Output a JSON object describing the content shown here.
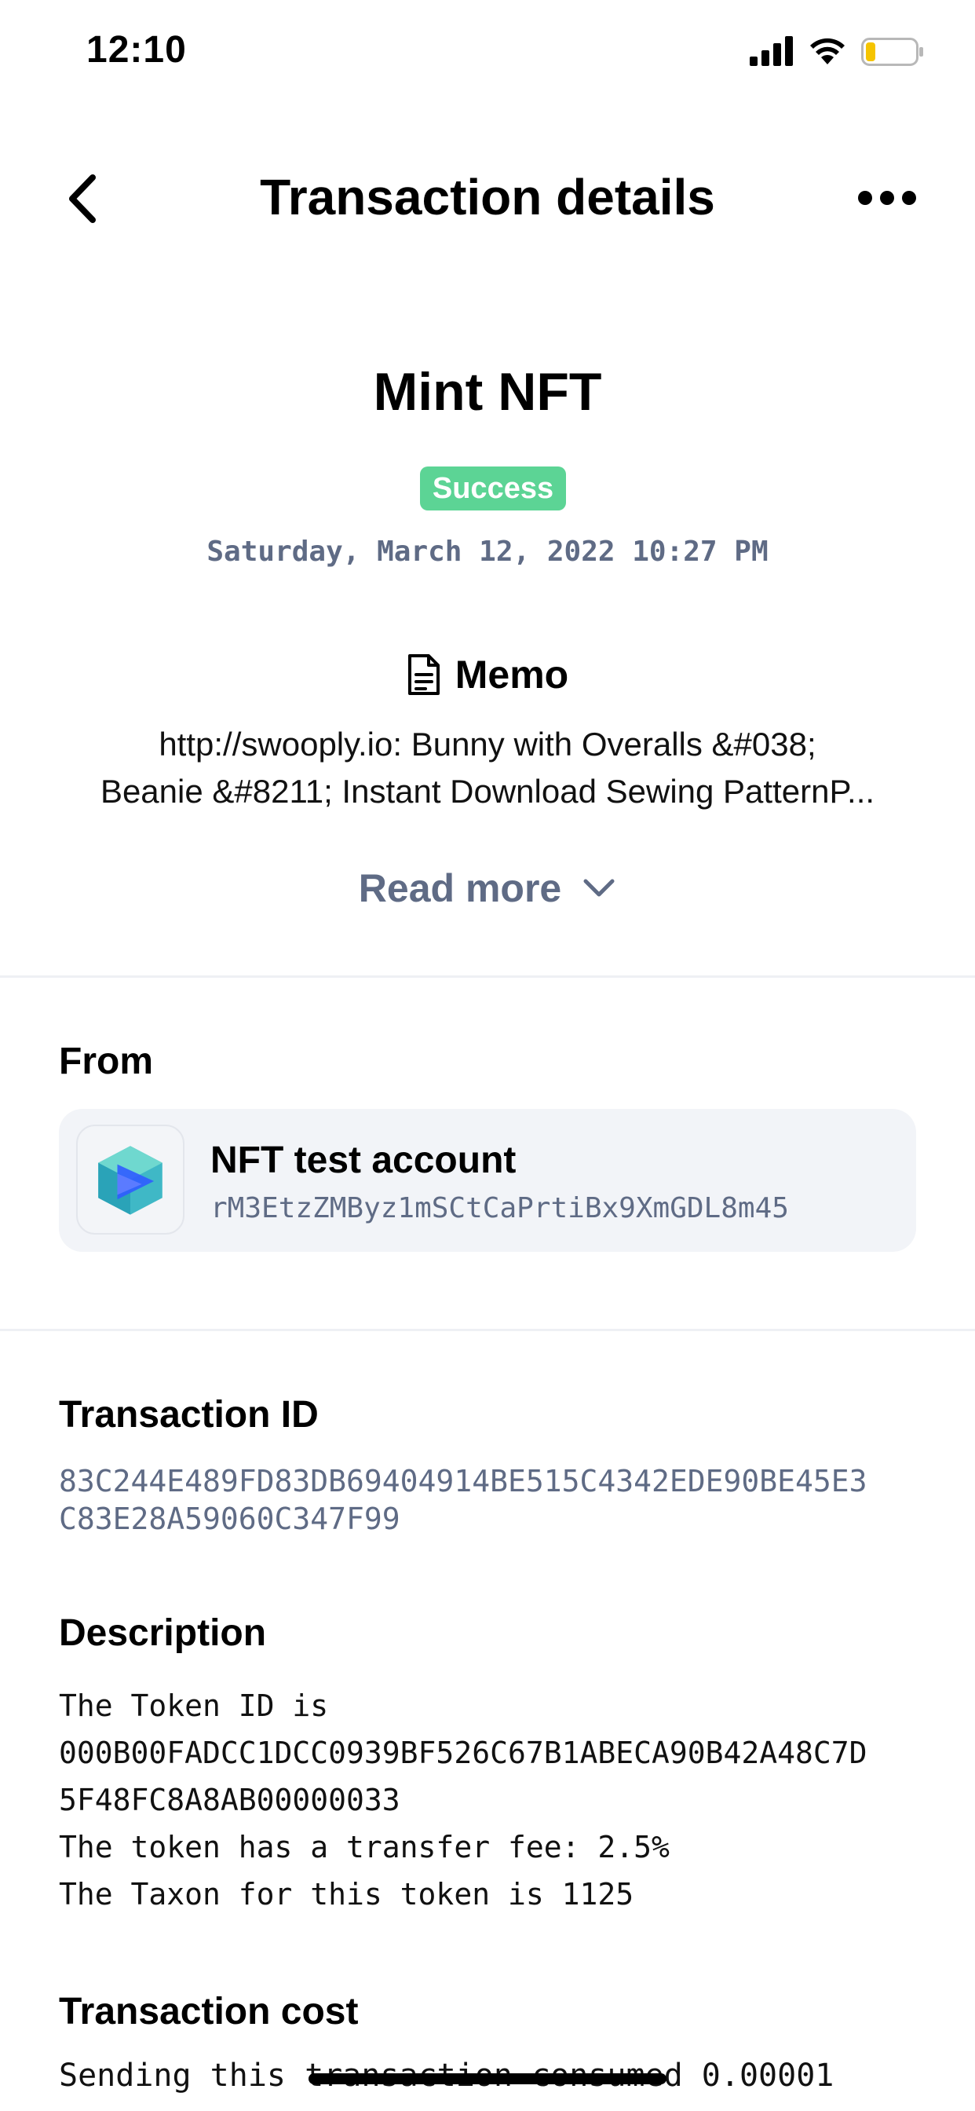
{
  "status_bar": {
    "time": "12:10"
  },
  "header": {
    "title": "Transaction details"
  },
  "summary": {
    "type": "Mint NFT",
    "status": "Success",
    "date": "Saturday, March 12, 2022 10:27 PM",
    "status_color": "#5cd495"
  },
  "memo": {
    "title": "Memo",
    "line1": "http://swooply.io: Bunny with Overalls &#038;",
    "line2": "Beanie &#8211; Instant Download Sewing PatternP...",
    "read_more": "Read more"
  },
  "from": {
    "label": "From",
    "account_name": "NFT test account",
    "account_address": "rM3EtzZMByz1mSCtCaPrtiBx9XmGDL8m45"
  },
  "transaction_id": {
    "label": "Transaction ID",
    "line1": "83C244E489FD83DB69404914BE515C4342EDE90BE45E3",
    "line2": "C83E28A59060C347F99"
  },
  "description": {
    "label": "Description",
    "line1": "The Token ID is",
    "line2": "000B00FADCC1DCC0939BF526C67B1ABECA90B42A48C7D",
    "line3": "5F48FC8A8AB00000033",
    "line4": "The token has a transfer fee: 2.5%",
    "line5": "The Taxon for this token is 1125"
  },
  "cost": {
    "label": "Transaction cost",
    "text": "Sending this transaction consumed 0.00001"
  },
  "icons": [
    "back-icon",
    "more-icon",
    "memo-document-icon",
    "chevron-down-icon",
    "account-avatar-icon",
    "signal-icon",
    "wifi-icon",
    "battery-icon"
  ]
}
